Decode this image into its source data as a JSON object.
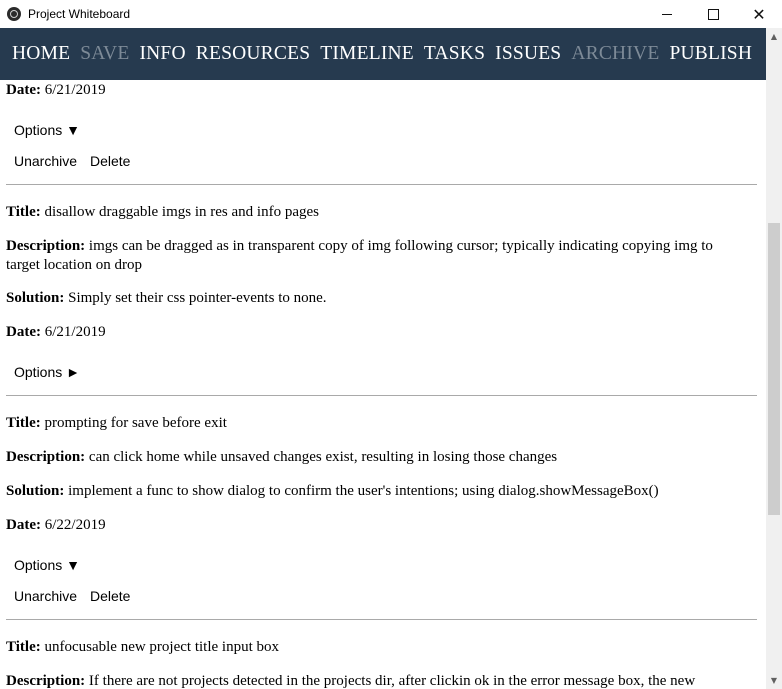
{
  "window": {
    "title": "Project Whiteboard",
    "minimize_icon": "minimize-icon",
    "maximize_icon": "maximize-icon",
    "close_glyph": "✕"
  },
  "nav": {
    "items": [
      {
        "label": "HOME",
        "enabled": true
      },
      {
        "label": "SAVE",
        "enabled": false
      },
      {
        "label": "INFO",
        "enabled": true
      },
      {
        "label": "RESOURCES",
        "enabled": true
      },
      {
        "label": "TIMELINE",
        "enabled": true
      },
      {
        "label": "TASKS",
        "enabled": true
      },
      {
        "label": "ISSUES",
        "enabled": true
      },
      {
        "label": "ARCHIVE",
        "enabled": false
      },
      {
        "label": "PUBLISH",
        "enabled": true
      }
    ],
    "background": "#263a4f"
  },
  "labels": {
    "title": "Title:",
    "description": "Description:",
    "solution": "Solution:",
    "date": "Date:",
    "unarchive": "Unarchive",
    "delete": "Delete"
  },
  "issues": [
    {
      "date": "6/21/2019",
      "options_label": "Options ▼"
    },
    {
      "title": "disallow draggable imgs in res and info pages",
      "description": "imgs can be dragged as in transparent copy of img following cursor; typically indicating copying img to target location on drop",
      "solution": "Simply set their css pointer-events to none.",
      "date": "6/21/2019",
      "options_label": "Options ►"
    },
    {
      "title": "prompting for save before exit",
      "description": "can click home while unsaved changes exist, resulting in losing those changes",
      "solution": "implement a func to show dialog to confirm the user's intentions; using dialog.showMessageBox()",
      "date": "6/22/2019",
      "options_label": "Options ▼"
    },
    {
      "title": "unfocusable new project title input box",
      "description": "If there are not projects detected in the projects dir, after clickin ok in the error message box, the new"
    }
  ],
  "scrollbar": {
    "up_glyph": "▲",
    "down_glyph": "▼"
  }
}
